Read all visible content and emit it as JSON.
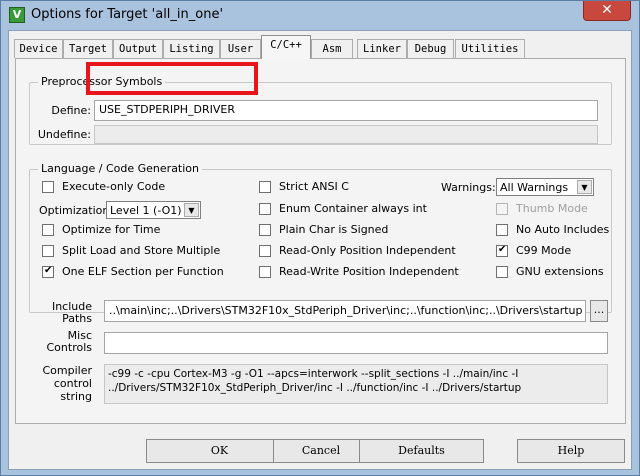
{
  "window": {
    "title": "Options for Target 'all_in_one'",
    "close_glyph": "✕"
  },
  "tabs": [
    {
      "label": "Device"
    },
    {
      "label": "Target"
    },
    {
      "label": "Output"
    },
    {
      "label": "Listing"
    },
    {
      "label": "User"
    },
    {
      "label": "C/C++"
    },
    {
      "label": "Asm"
    },
    {
      "label": "Linker"
    },
    {
      "label": "Debug"
    },
    {
      "label": "Utilities"
    }
  ],
  "preprocessor": {
    "legend": "Preprocessor Symbols",
    "define_label": "Define:",
    "define_value": "USE_STDPERIPH_DRIVER",
    "undefine_label": "Undefine:",
    "undefine_value": ""
  },
  "language": {
    "legend": "Language / Code Generation",
    "execute_only": "Execute-only Code",
    "optimization_label": "Optimization:",
    "optimization_value": "Level 1 (-O1)",
    "optimize_time": "Optimize for Time",
    "split_load": "Split Load and Store Multiple",
    "one_elf": "One ELF Section per Function",
    "strict_ansi": "Strict ANSI C",
    "enum_container": "Enum Container always int",
    "plain_char": "Plain Char is Signed",
    "ro_pi": "Read-Only Position Independent",
    "rw_pi": "Read-Write Position Independent",
    "warnings_label": "Warnings:",
    "warnings_value": "All Warnings",
    "thumb_mode": "Thumb Mode",
    "no_auto_includes": "No Auto Includes",
    "c99_mode": "C99 Mode",
    "gnu_extensions": "GNU extensions"
  },
  "paths": {
    "include_label_1": "Include",
    "include_label_2": "Paths",
    "include_value": "..\\main\\inc;..\\Drivers\\STM32F10x_StdPeriph_Driver\\inc;..\\function\\inc;..\\Drivers\\startup",
    "browse_label": "...",
    "misc_label_1": "Misc",
    "misc_label_2": "Controls",
    "misc_value": "",
    "compiler_label_1": "Compiler",
    "compiler_label_2": "control",
    "compiler_label_3": "string",
    "compiler_line_1": "-c99 -c -cpu Cortex-M3 -g -O1 --apcs=interwork --split_sections -I ../main/inc -I",
    "compiler_line_2": "../Drivers/STM32F10x_StdPeriph_Driver/inc -I ../function/inc -I ../Drivers/startup"
  },
  "buttons": {
    "ok": "OK",
    "cancel": "Cancel",
    "defaults": "Defaults",
    "help": "Help"
  },
  "colors": {
    "highlight": "#e8151b",
    "titlebar": "#a9c2dd",
    "close": "#c9483e"
  }
}
